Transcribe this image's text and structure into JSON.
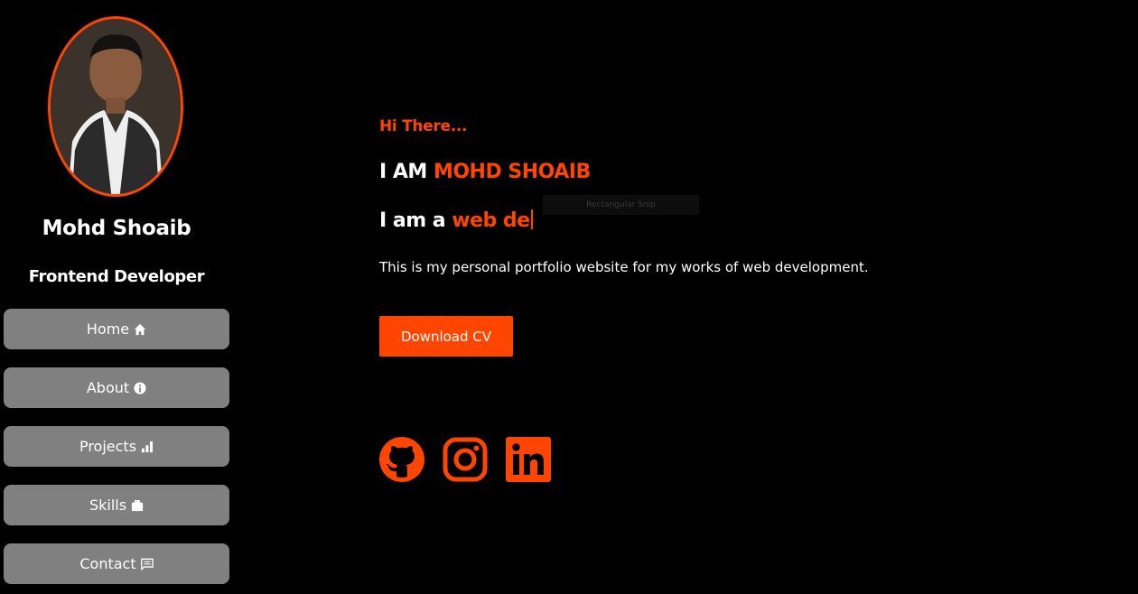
{
  "profile": {
    "name": "Mohd Shoaib",
    "role": "Frontend Developer",
    "avatar_alt": "profile photo"
  },
  "nav": [
    {
      "label": "Home",
      "icon": "home-icon"
    },
    {
      "label": "About",
      "icon": "info-icon"
    },
    {
      "label": "Projects",
      "icon": "bar-chart-icon"
    },
    {
      "label": "Skills",
      "icon": "briefcase-icon"
    },
    {
      "label": "Contact",
      "icon": "message-icon"
    }
  ],
  "hero": {
    "greeting": "Hi There...",
    "iam_prefix": "I AM ",
    "iam_name": "MOHD SHOAIB",
    "typing_prefix": "I am a ",
    "typing_text": "web de",
    "tooltip": "Rectangular Snip",
    "description": "This is my personal portfolio website for my works of web development.",
    "cv_button": "Download CV"
  },
  "social": [
    {
      "name": "github-icon"
    },
    {
      "name": "instagram-icon"
    },
    {
      "name": "linkedin-icon"
    }
  ],
  "colors": {
    "accent": "#ff4500",
    "background": "#000000",
    "nav_button": "#808080",
    "text": "#ffffff"
  }
}
